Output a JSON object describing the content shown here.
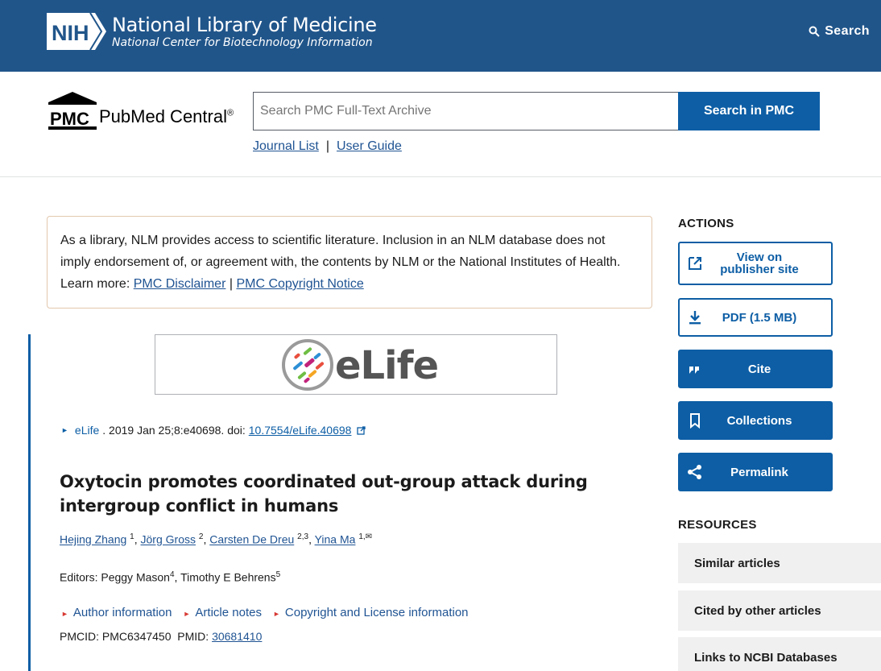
{
  "nlm": {
    "title": "National Library of Medicine",
    "subtitle": "National Center for Biotechnology Information",
    "search_label": "Search"
  },
  "pmc": {
    "logo_text": "PMC",
    "name": "PubMed Central",
    "reg": "®",
    "search_placeholder": "Search PMC Full-Text Archive",
    "search_button": "Search in PMC",
    "journal_list": "Journal List",
    "separator": "|",
    "user_guide": "User Guide"
  },
  "disclaimer": {
    "text": "As a library, NLM provides access to scientific literature. Inclusion in an NLM database does not imply endorsement of, or agreement with, the contents by NLM or the National Institutes of Health.",
    "learn_more": "Learn more:",
    "link1": "PMC Disclaimer",
    "sep": "|",
    "link2": "PMC Copyright Notice"
  },
  "article": {
    "journal_logo_text": "eLife",
    "citation_journal": "eLife",
    "citation_text": ". 2019 Jan 25;8:e40698. doi:",
    "doi": "10.7554/eLife.40698",
    "title": "Oxytocin promotes coordinated out-group attack during intergroup conflict in humans",
    "authors": [
      {
        "name": "Hejing Zhang",
        "aff": "1"
      },
      {
        "name": "Jörg Gross",
        "aff": "2"
      },
      {
        "name": "Carsten De Dreu",
        "aff": "2,3"
      },
      {
        "name": "Yina Ma",
        "aff": "1,"
      }
    ],
    "editors_label": "Editors: ",
    "editor1": "Peggy Mason",
    "editor1_aff": "4",
    "editor2": "Timothy E Behrens",
    "editor2_aff": "5",
    "info_links": [
      "Author information",
      "Article notes",
      "Copyright and License information"
    ],
    "pmcid_label": "PMCID: ",
    "pmcid": "PMC6347450",
    "pmid_label": "PMID: ",
    "pmid": "30681410"
  },
  "actions": {
    "heading": "ACTIONS",
    "view_line1": "View on",
    "view_line2": "publisher site",
    "pdf": "PDF (1.5 MB)",
    "cite": "Cite",
    "collections": "Collections",
    "permalink": "Permalink"
  },
  "resources": {
    "heading": "RESOURCES",
    "items": [
      "Similar articles",
      "Cited by other articles",
      "Links to NCBI Databases"
    ]
  },
  "colors": {
    "nlm_blue": "#20558a",
    "primary": "#0d5ea5",
    "link": "#205493",
    "accent_red": "#d83933"
  }
}
